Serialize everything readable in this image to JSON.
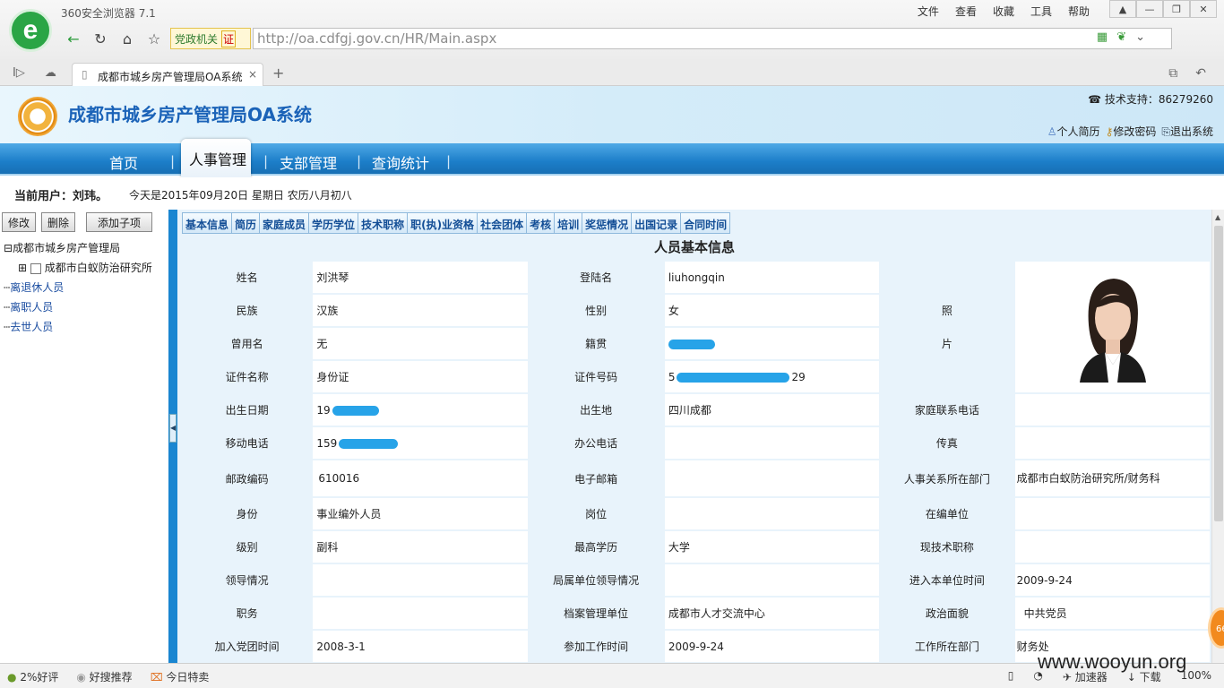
{
  "browser": {
    "app_title": "360安全浏览器 7.1",
    "menu": [
      "文件",
      "查看",
      "收藏",
      "工具",
      "帮助"
    ],
    "gov_label": "党政机关",
    "gov_badge": "证",
    "url": "http://oa.cdfgj.gov.cn/HR/Main.aspx",
    "tab_title": "成都市城乡房产管理局OA系统",
    "tab_close": "×",
    "new_tab": "+"
  },
  "header": {
    "title": "成都市城乡房产管理局OA系统",
    "support": "技术支持：86279260",
    "links": [
      "个人简历",
      "修改密码",
      "退出系统"
    ]
  },
  "nav": {
    "items": [
      "首页",
      "人事管理",
      "支部管理",
      "查询统计"
    ],
    "active": "人事管理"
  },
  "userbar": {
    "current_user": "当前用户：刘玮。",
    "date_text": "今天是2015年09月20日 星期日 农历八月初八"
  },
  "sidebar": {
    "buttons": [
      "修改",
      "删除",
      "添加子项"
    ],
    "tree": {
      "root": "成都市城乡房产管理局",
      "child": "成都市白蚁防治研究所",
      "links": [
        "离退休人员",
        "离职人员",
        "去世人员"
      ]
    }
  },
  "main": {
    "tabs": [
      "基本信息",
      "简历",
      "家庭成员",
      "学历学位",
      "技术职称",
      "职(执)业资格",
      "社会团体",
      "考核",
      "培训",
      "奖惩情况",
      "出国记录",
      "合同时间"
    ],
    "title": "人员基本信息",
    "photo_label_1": "照",
    "photo_label_2": "片",
    "rows": [
      {
        "l1": "姓名",
        "v1": "刘洪琴",
        "l2": "登陆名",
        "v2": "liuhongqin"
      },
      {
        "l1": "民族",
        "v1": "汉族",
        "l2": "性别",
        "v2": "女"
      },
      {
        "l1": "曾用名",
        "v1": "无",
        "l2": "籍贯",
        "v2": ""
      },
      {
        "l1": "证件名称",
        "v1": "身份证",
        "l2": "证件号码",
        "v2_prefix": "5",
        "v2_suffix": "29"
      },
      {
        "l1": "出生日期",
        "v1_prefix": "19",
        "l2": "出生地",
        "v2": "四川成都",
        "l3": "家庭联系电话",
        "v3": ""
      },
      {
        "l1": "移动电话",
        "v1_prefix": "159",
        "l2": "办公电话",
        "v2": "",
        "l3": "传真",
        "v3": ""
      },
      {
        "l1": "邮政编码",
        "v1": "610016",
        "l2": "电子邮箱",
        "v2": "",
        "l3": "人事关系所在部门",
        "v3": "成都市白蚁防治研究所/财务科"
      },
      {
        "l1": "身份",
        "v1": "事业编外人员",
        "l2": "岗位",
        "v2": "",
        "l3": "在编单位",
        "v3": ""
      },
      {
        "l1": "级别",
        "v1": "副科",
        "l2": "最高学历",
        "v2": "大学",
        "l3": "现技术职称",
        "v3": ""
      },
      {
        "l1": "领导情况",
        "v1": "",
        "l2": "局属单位领导情况",
        "v2": "",
        "l3": "进入本单位时间",
        "v3": "2009-9-24"
      },
      {
        "l1": "职务",
        "v1": "",
        "l2": "档案管理单位",
        "v2": "成都市人才交流中心",
        "l3": "政治面貌",
        "v3": "中共党员"
      },
      {
        "l1": "加入党团时间",
        "v1": "2008-3-1",
        "l2": "参加工作时间",
        "v2": "2009-9-24",
        "l3": "工作所在部门",
        "v3": "财务处"
      }
    ]
  },
  "statusbar": {
    "left": [
      "2%好评",
      "好搜推荐",
      "今日特卖"
    ],
    "right": [
      "加速器",
      "下载",
      "100%"
    ],
    "badge": "66"
  },
  "watermark": "www.wooyun.org",
  "colors": {
    "nav_blue": "#1c7ec9",
    "title_blue": "#1b63b8",
    "redact": "#27a3e8"
  }
}
